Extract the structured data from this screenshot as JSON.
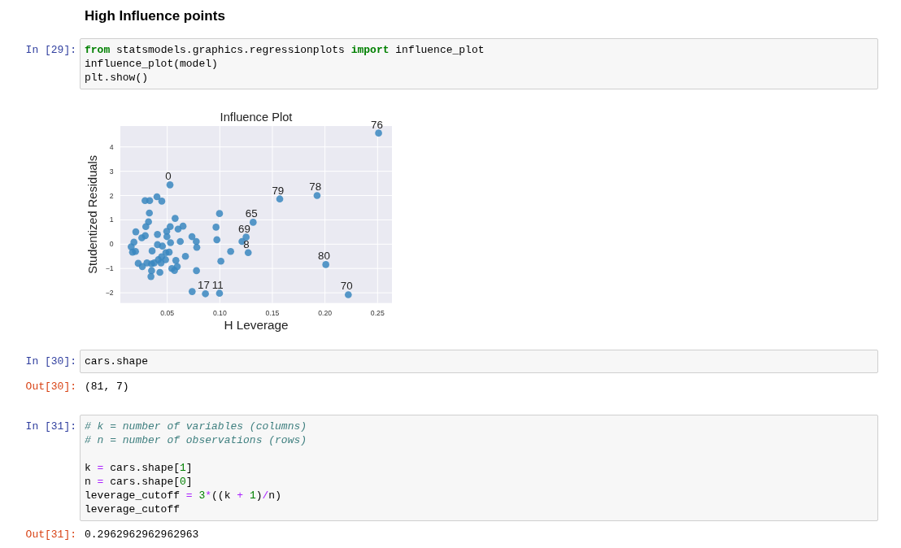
{
  "heading": "High Influence points",
  "cells": [
    {
      "prompt": "In [29]:",
      "lines": [
        {
          "kind": "code",
          "tokens": [
            {
              "text": "from",
              "kind": "keyword"
            },
            {
              "text": " statsmodels.graphics.regressionplots ",
              "kind": "plain"
            },
            {
              "text": "import",
              "kind": "keyword"
            },
            {
              "text": " influence_plot",
              "kind": "plain"
            }
          ]
        },
        {
          "kind": "code",
          "tokens": [
            {
              "text": "influence_plot(model)",
              "kind": "plain"
            }
          ]
        },
        {
          "kind": "code",
          "tokens": [
            {
              "text": "plt.show()",
              "kind": "plain"
            }
          ]
        }
      ],
      "output": {
        "kind": "figure",
        "chart_data": {
          "type": "scatter",
          "title": "Influence Plot",
          "xlabel": "H Leverage",
          "ylabel": "Studentized Residuals",
          "grid": true,
          "xlim": [
            0.0054,
            0.2637
          ],
          "ylim": [
            -2.42,
            4.86
          ],
          "xticks": [
            {
              "value": 0.05,
              "label": "0.05"
            },
            {
              "value": 0.1,
              "label": "0.10"
            },
            {
              "value": 0.15,
              "label": "0.15"
            },
            {
              "value": 0.2,
              "label": "0.20"
            },
            {
              "value": 0.25,
              "label": "0.25"
            }
          ],
          "yticks": [
            {
              "value": -2,
              "label": "−2"
            },
            {
              "value": -1,
              "label": "−1"
            },
            {
              "value": 0,
              "label": "0"
            },
            {
              "value": 1,
              "label": "1"
            },
            {
              "value": 2,
              "label": "2"
            },
            {
              "value": 3,
              "label": "3"
            },
            {
              "value": 4,
              "label": "4"
            }
          ],
          "x": [
            0.251,
            0.0526,
            0.157,
            0.1925,
            0.1317,
            0.125,
            0.127,
            0.2008,
            0.2222,
            0.0863,
            0.0997,
            0.0737,
            0.0289,
            0.0333,
            0.0402,
            0.0448,
            0.033,
            0.0575,
            0.0322,
            0.0296,
            0.0528,
            0.0495,
            0.065,
            0.0603,
            0.0201,
            0.0407,
            0.0291,
            0.0497,
            0.0735,
            0.0258,
            0.0964,
            0.0997,
            0.0972,
            0.0624,
            0.0776,
            0.1211,
            0.0183,
            0.0157,
            0.017,
            0.0198,
            0.0356,
            0.0407,
            0.0454,
            0.0531,
            0.0487,
            0.0518,
            0.0781,
            0.1103,
            0.0673,
            0.101,
            0.0582,
            0.0446,
            0.0415,
            0.0484,
            0.0224,
            0.0263,
            0.0307,
            0.0351,
            0.0376,
            0.0441,
            0.0544,
            0.0595,
            0.0569,
            0.0351,
            0.0345,
            0.043,
            0.0778
          ],
          "series": [
            {
              "color": "#3a87c0",
              "values": [
                4.57,
                2.44,
                1.86,
                2.0,
                0.9,
                0.29,
                -0.35,
                -0.84,
                -2.08,
                -2.04,
                -2.02,
                -1.95,
                1.79,
                1.79,
                1.95,
                1.77,
                1.28,
                1.06,
                0.92,
                0.72,
                0.72,
                0.53,
                0.74,
                0.62,
                0.51,
                0.4,
                0.35,
                0.31,
                0.31,
                0.26,
                0.7,
                1.26,
                0.18,
                0.11,
                0.11,
                0.11,
                0.08,
                -0.11,
                -0.33,
                -0.3,
                -0.28,
                -0.02,
                -0.08,
                0.06,
                -0.35,
                -0.33,
                -0.13,
                -0.3,
                -0.5,
                -0.7,
                -0.67,
                -0.52,
                -0.64,
                -0.64,
                -0.79,
                -0.92,
                -0.77,
                -0.81,
                -0.77,
                -0.77,
                -1.0,
                -0.92,
                -1.08,
                -1.09,
                -1.33,
                -1.16,
                -1.09
              ]
            }
          ],
          "annotations": [
            {
              "x": 0.251,
              "y": 4.57,
              "text": "76"
            },
            {
              "x": 0.0526,
              "y": 2.44,
              "text": "0"
            },
            {
              "x": 0.157,
              "y": 1.86,
              "text": "79"
            },
            {
              "x": 0.1925,
              "y": 2.0,
              "text": "78"
            },
            {
              "x": 0.1317,
              "y": 0.9,
              "text": "65"
            },
            {
              "x": 0.125,
              "y": 0.29,
              "text": "69"
            },
            {
              "x": 0.127,
              "y": -0.35,
              "text": "8"
            },
            {
              "x": 0.2008,
              "y": -0.84,
              "text": "80"
            },
            {
              "x": 0.2222,
              "y": -2.08,
              "text": "70"
            },
            {
              "x": 0.0863,
              "y": -2.04,
              "text": "17"
            },
            {
              "x": 0.0997,
              "y": -2.02,
              "text": "11"
            }
          ]
        }
      }
    },
    {
      "prompt": "In [30]:",
      "lines": [
        {
          "kind": "code",
          "tokens": [
            {
              "text": "cars.shape",
              "kind": "plain"
            }
          ]
        }
      ],
      "output": {
        "kind": "text",
        "prompt": "Out[30]:",
        "text": "(81, 7)"
      }
    },
    {
      "prompt": "In [31]:",
      "lines": [
        {
          "kind": "code",
          "tokens": [
            {
              "text": "# k = number of variables (columns)",
              "kind": "comment"
            }
          ]
        },
        {
          "kind": "code",
          "tokens": [
            {
              "text": "# n = number of observations (rows)",
              "kind": "comment"
            }
          ]
        },
        {
          "kind": "blank"
        },
        {
          "kind": "code",
          "tokens": [
            {
              "text": "k ",
              "kind": "plain"
            },
            {
              "text": "=",
              "kind": "op"
            },
            {
              "text": " cars.shape[",
              "kind": "plain"
            },
            {
              "text": "1",
              "kind": "number"
            },
            {
              "text": "]",
              "kind": "plain"
            }
          ]
        },
        {
          "kind": "code",
          "tokens": [
            {
              "text": "n ",
              "kind": "plain"
            },
            {
              "text": "=",
              "kind": "op"
            },
            {
              "text": " cars.shape[",
              "kind": "plain"
            },
            {
              "text": "0",
              "kind": "number"
            },
            {
              "text": "]",
              "kind": "plain"
            }
          ]
        },
        {
          "kind": "code",
          "tokens": [
            {
              "text": "leverage_cutoff ",
              "kind": "plain"
            },
            {
              "text": "= ",
              "kind": "op"
            },
            {
              "text": "3",
              "kind": "number"
            },
            {
              "text": "*",
              "kind": "op"
            },
            {
              "text": "((k ",
              "kind": "plain"
            },
            {
              "text": "+ ",
              "kind": "op"
            },
            {
              "text": "1",
              "kind": "number"
            },
            {
              "text": ")",
              "kind": "plain"
            },
            {
              "text": "/",
              "kind": "op"
            },
            {
              "text": "n)",
              "kind": "plain"
            }
          ]
        },
        {
          "kind": "code",
          "tokens": [
            {
              "text": "leverage_cutoff",
              "kind": "plain"
            }
          ]
        }
      ],
      "output": {
        "kind": "text",
        "prompt": "Out[31]:",
        "text": "0.2962962962962963"
      }
    }
  ]
}
